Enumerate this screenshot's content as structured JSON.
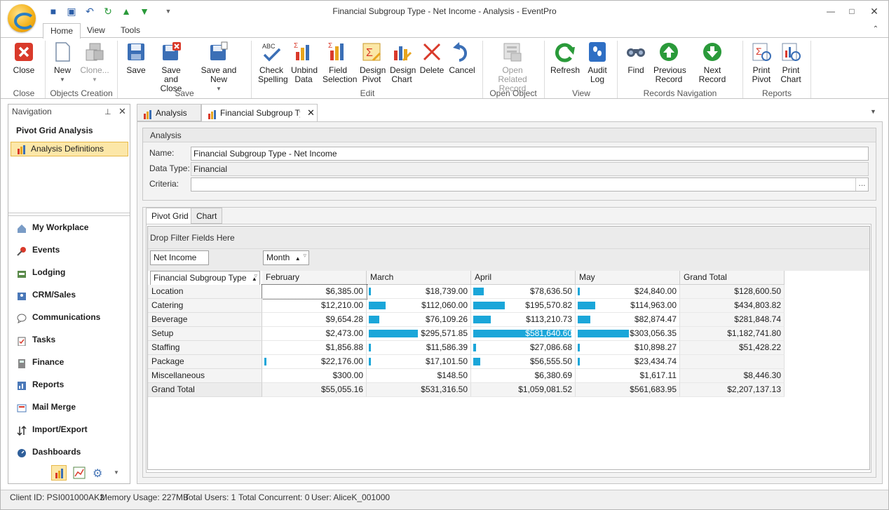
{
  "window": {
    "title": "Financial Subgroup Type - Net Income - Analysis - EventPro"
  },
  "ribbon_tabs": [
    "Home",
    "View",
    "Tools"
  ],
  "ribbon": {
    "buttons": [
      {
        "label": "Close",
        "icon": "close-icon"
      },
      {
        "label": "New",
        "icon": "new-document-icon"
      },
      {
        "label": "Clone...",
        "icon": "clone-icon"
      },
      {
        "label": "Save",
        "icon": "save-icon"
      },
      {
        "label": "Save and Close",
        "icon": "save-close-icon"
      },
      {
        "label": "Save and New",
        "icon": "save-new-icon"
      },
      {
        "label": "Check Spelling",
        "icon": "spellcheck-icon"
      },
      {
        "label": "Unbind Data",
        "icon": "unbind-icon"
      },
      {
        "label": "Field Selection",
        "icon": "field-selection-icon"
      },
      {
        "label": "Design Pivot",
        "icon": "design-pivot-icon"
      },
      {
        "label": "Design Chart",
        "icon": "design-chart-icon"
      },
      {
        "label": "Delete",
        "icon": "delete-icon"
      },
      {
        "label": "Cancel",
        "icon": "undo-icon"
      },
      {
        "label": "Open Related Record",
        "icon": "open-record-icon"
      },
      {
        "label": "Refresh",
        "icon": "refresh-icon"
      },
      {
        "label": "Audit Log",
        "icon": "audit-log-icon"
      },
      {
        "label": "Find",
        "icon": "binoculars-icon"
      },
      {
        "label": "Previous Record",
        "icon": "up-arrow-icon"
      },
      {
        "label": "Next Record",
        "icon": "down-arrow-icon"
      },
      {
        "label": "Print Pivot",
        "icon": "print-pivot-icon"
      },
      {
        "label": "Print Chart",
        "icon": "print-chart-icon"
      }
    ],
    "groups": [
      "Close",
      "Objects Creation",
      "Save",
      "Edit",
      "Open Object",
      "View",
      "Records Navigation",
      "Reports"
    ]
  },
  "navigation": {
    "title": "Navigation",
    "section": "Pivot Grid Analysis",
    "selected": "Analysis Definitions",
    "items": [
      "My Workplace",
      "Events",
      "Lodging",
      "CRM/Sales",
      "Communications",
      "Tasks",
      "Finance",
      "Reports",
      "Mail Merge",
      "Import/Export",
      "Dashboards"
    ]
  },
  "doc_tabs": [
    "Analysis",
    "Financial Subgroup Type"
  ],
  "analysis": {
    "header": "Analysis",
    "name_label": "Name:",
    "name_value": "Financial Subgroup Type - Net Income",
    "datatype_label": "Data Type:",
    "datatype_value": "Financial",
    "criteria_label": "Criteria:",
    "criteria_value": "",
    "ellipsis": "..."
  },
  "pivot_tabs": [
    "Pivot Grid",
    "Chart"
  ],
  "pivot": {
    "filter_hint": "Drop Filter Fields Here",
    "data_field": "Net Income",
    "column_field": "Month",
    "row_field": "Financial Subgroup Type",
    "columns": [
      "February",
      "March",
      "April",
      "May",
      "Grand Total"
    ],
    "rows": [
      {
        "label": "Location",
        "values": [
          "$6,385.00",
          "$18,739.00",
          "$78,636.50",
          "$24,840.00",
          "$128,600.50"
        ],
        "bars": [
          0,
          0.02,
          0.11,
          0.02
        ]
      },
      {
        "label": "Catering",
        "values": [
          "$12,210.00",
          "$112,060.00",
          "$195,570.82",
          "$114,963.00",
          "$434,803.82"
        ],
        "bars": [
          0,
          0.17,
          0.32,
          0.18
        ]
      },
      {
        "label": "Beverage",
        "values": [
          "$9,654.28",
          "$76,109.26",
          "$113,210.73",
          "$82,874.47",
          "$281,848.74"
        ],
        "bars": [
          0,
          0.11,
          0.18,
          0.13
        ]
      },
      {
        "label": "Setup",
        "values": [
          "$2,473.00",
          "$295,571.85",
          "$581,640.60",
          "$303,056.35",
          "$1,182,741.80"
        ],
        "bars": [
          0,
          0.5,
          1.0,
          0.52
        ]
      },
      {
        "label": "Staffing",
        "values": [
          "$1,856.88",
          "$11,586.39",
          "$27,086.68",
          "$10,898.27",
          "$51,428.22"
        ],
        "bars": [
          0,
          0.01,
          0.03,
          0.01
        ]
      },
      {
        "label": "Package",
        "values": [
          "$22,176.00",
          "$17,101.50",
          "$56,555.50",
          "$23,434.74"
        ],
        "bars": [
          0.02,
          0.01,
          0.07,
          0.02
        ]
      },
      {
        "label": "Miscellaneous",
        "values": [
          "$300.00",
          "$148.50",
          "$6,380.69",
          "$1,617.11",
          "$8,446.30"
        ],
        "bars": [
          0,
          0,
          0,
          0
        ]
      }
    ],
    "grand_total": {
      "label": "Grand Total",
      "values": [
        "$55,055.16",
        "$531,316.50",
        "$1,059,081.52",
        "$561,683.95",
        "$2,207,137.13"
      ]
    }
  },
  "status": {
    "client": "Client ID: PSI001000AK2",
    "memory": "Memory Usage: 227MB",
    "users": "Total Users: 1",
    "concurrent": "Total Concurrent: 0",
    "user": "User: AliceK_001000"
  },
  "colors": {
    "bar": "#1aa6d9",
    "selection": "#fce7a8"
  }
}
